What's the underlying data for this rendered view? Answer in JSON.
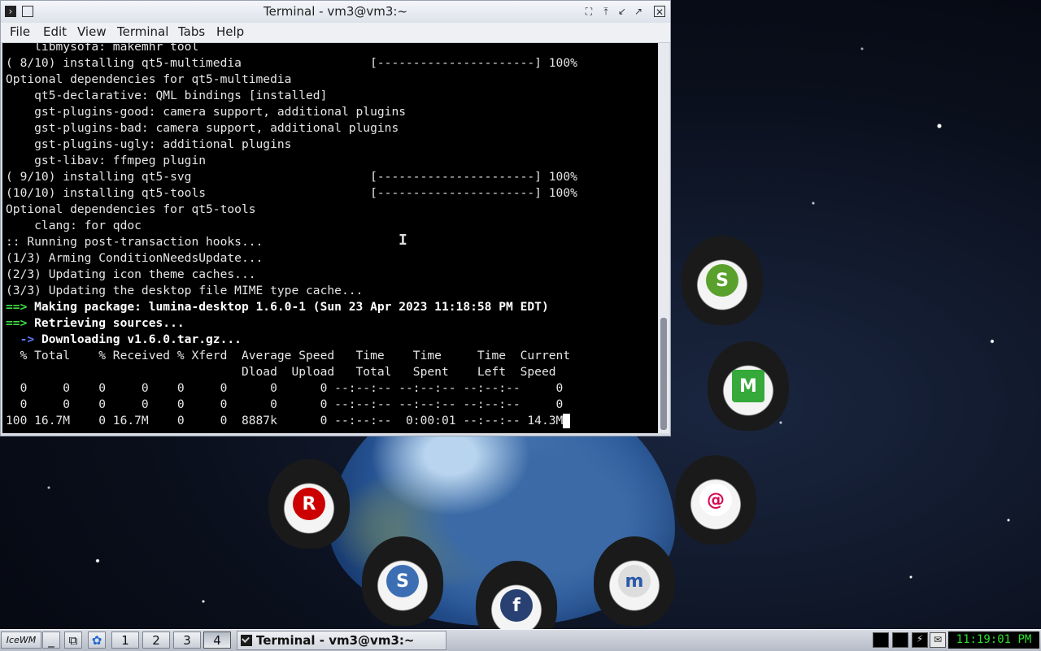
{
  "window": {
    "title": "Terminal - vm3@vm3:~"
  },
  "menu": [
    "File",
    "Edit",
    "View",
    "Terminal",
    "Tabs",
    "Help"
  ],
  "terminal_lines": [
    "    libmysofa: makemhr tool",
    "( 8/10) installing qt5-multimedia                  [----------------------] 100%",
    "Optional dependencies for qt5-multimedia",
    "    qt5-declarative: QML bindings [installed]",
    "    gst-plugins-good: camera support, additional plugins",
    "    gst-plugins-bad: camera support, additional plugins",
    "    gst-plugins-ugly: additional plugins",
    "    gst-libav: ffmpeg plugin",
    "( 9/10) installing qt5-svg                         [----------------------] 100%",
    "(10/10) installing qt5-tools                       [----------------------] 100%",
    "Optional dependencies for qt5-tools",
    "    clang: for qdoc",
    ":: Running post-transaction hooks...",
    "(1/3) Arming ConditionNeedsUpdate...",
    "(2/3) Updating icon theme caches...",
    "(3/3) Updating the desktop file MIME type cache..."
  ],
  "highlight_lines": {
    "making_prefix": "==>",
    "making_text": " Making package: lumina-desktop 1.6.0-1 (Sun 23 Apr 2023 11:18:58 PM EDT)",
    "retrieving_prefix": "==>",
    "retrieving_text": " Retrieving sources...",
    "downloading_prefix": "  ->",
    "downloading_text": " Downloading v1.6.0.tar.gz..."
  },
  "curl_lines": [
    "  % Total    % Received % Xferd  Average Speed   Time    Time     Time  Current",
    "                                 Dload  Upload   Total   Spent    Left  Speed",
    "  0     0    0     0    0     0      0      0 --:--:-- --:--:-- --:--:--     0",
    "  0     0    0     0    0     0      0      0 --:--:-- --:--:-- --:--:--     0",
    "100 16.7M    0 16.7M    0     0  8887k      0 --:--:--  0:00:01 --:--:-- 14.3M"
  ],
  "scrollbar": {
    "position_fraction": 0.95
  },
  "taskbar": {
    "start_label": "IceWM",
    "workspaces": [
      "1",
      "2",
      "3",
      "4"
    ],
    "active_workspace": "4",
    "task_title": "Terminal - vm3@vm3:~",
    "clock": "11:19:01 PM"
  },
  "icons": {
    "window_menu": "terminal-icon",
    "restore": "restore-icon",
    "fullscreen": "fullscreen-icon",
    "rollup": "rollup-icon",
    "minimize": "minimize-icon",
    "maximize": "maximize-icon",
    "close": "close-icon"
  }
}
